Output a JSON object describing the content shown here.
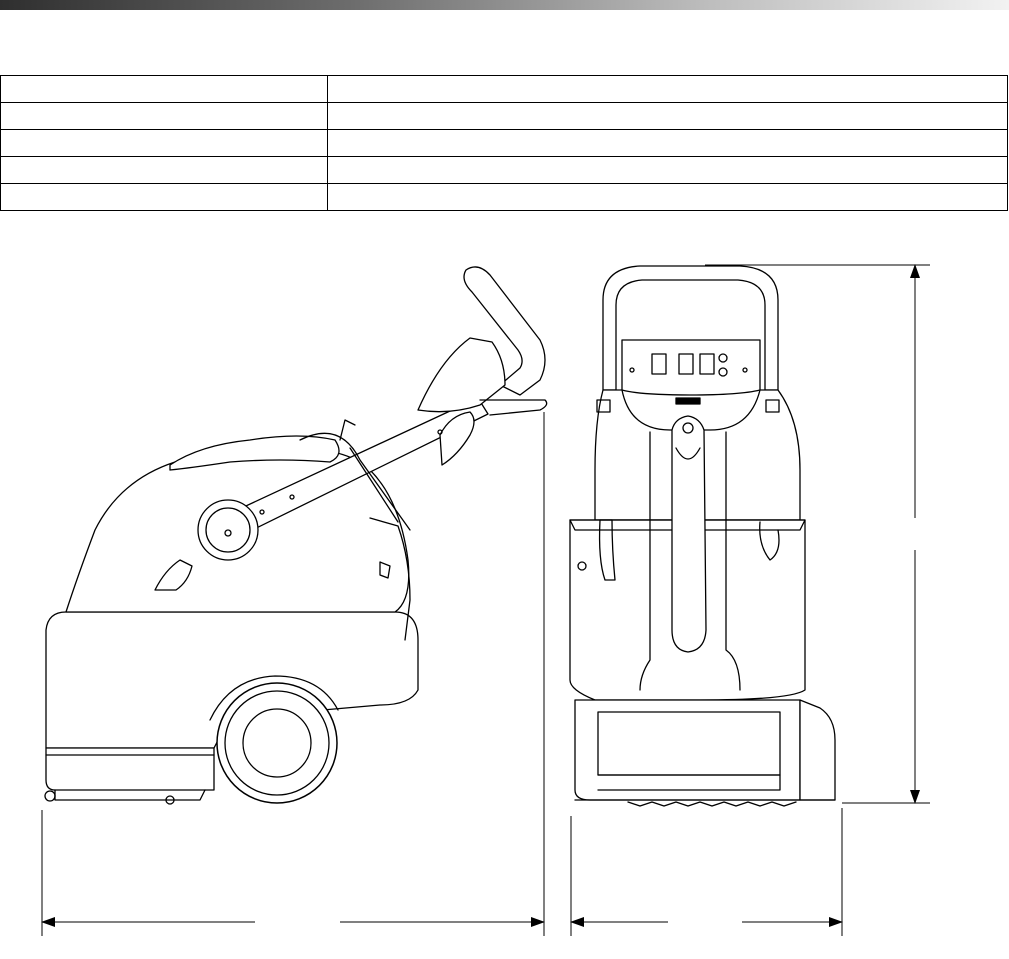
{
  "spec_table": {
    "rows": [
      {
        "label": "",
        "value": ""
      },
      {
        "label": "",
        "value": ""
      },
      {
        "label": "",
        "value": ""
      },
      {
        "label": "",
        "value": ""
      },
      {
        "label": "",
        "value": ""
      }
    ]
  },
  "views": {
    "side": {
      "name": "side-view"
    },
    "front": {
      "name": "front-view"
    }
  },
  "dimensions": {
    "length_label": "",
    "width_label": "",
    "height_label": ""
  }
}
